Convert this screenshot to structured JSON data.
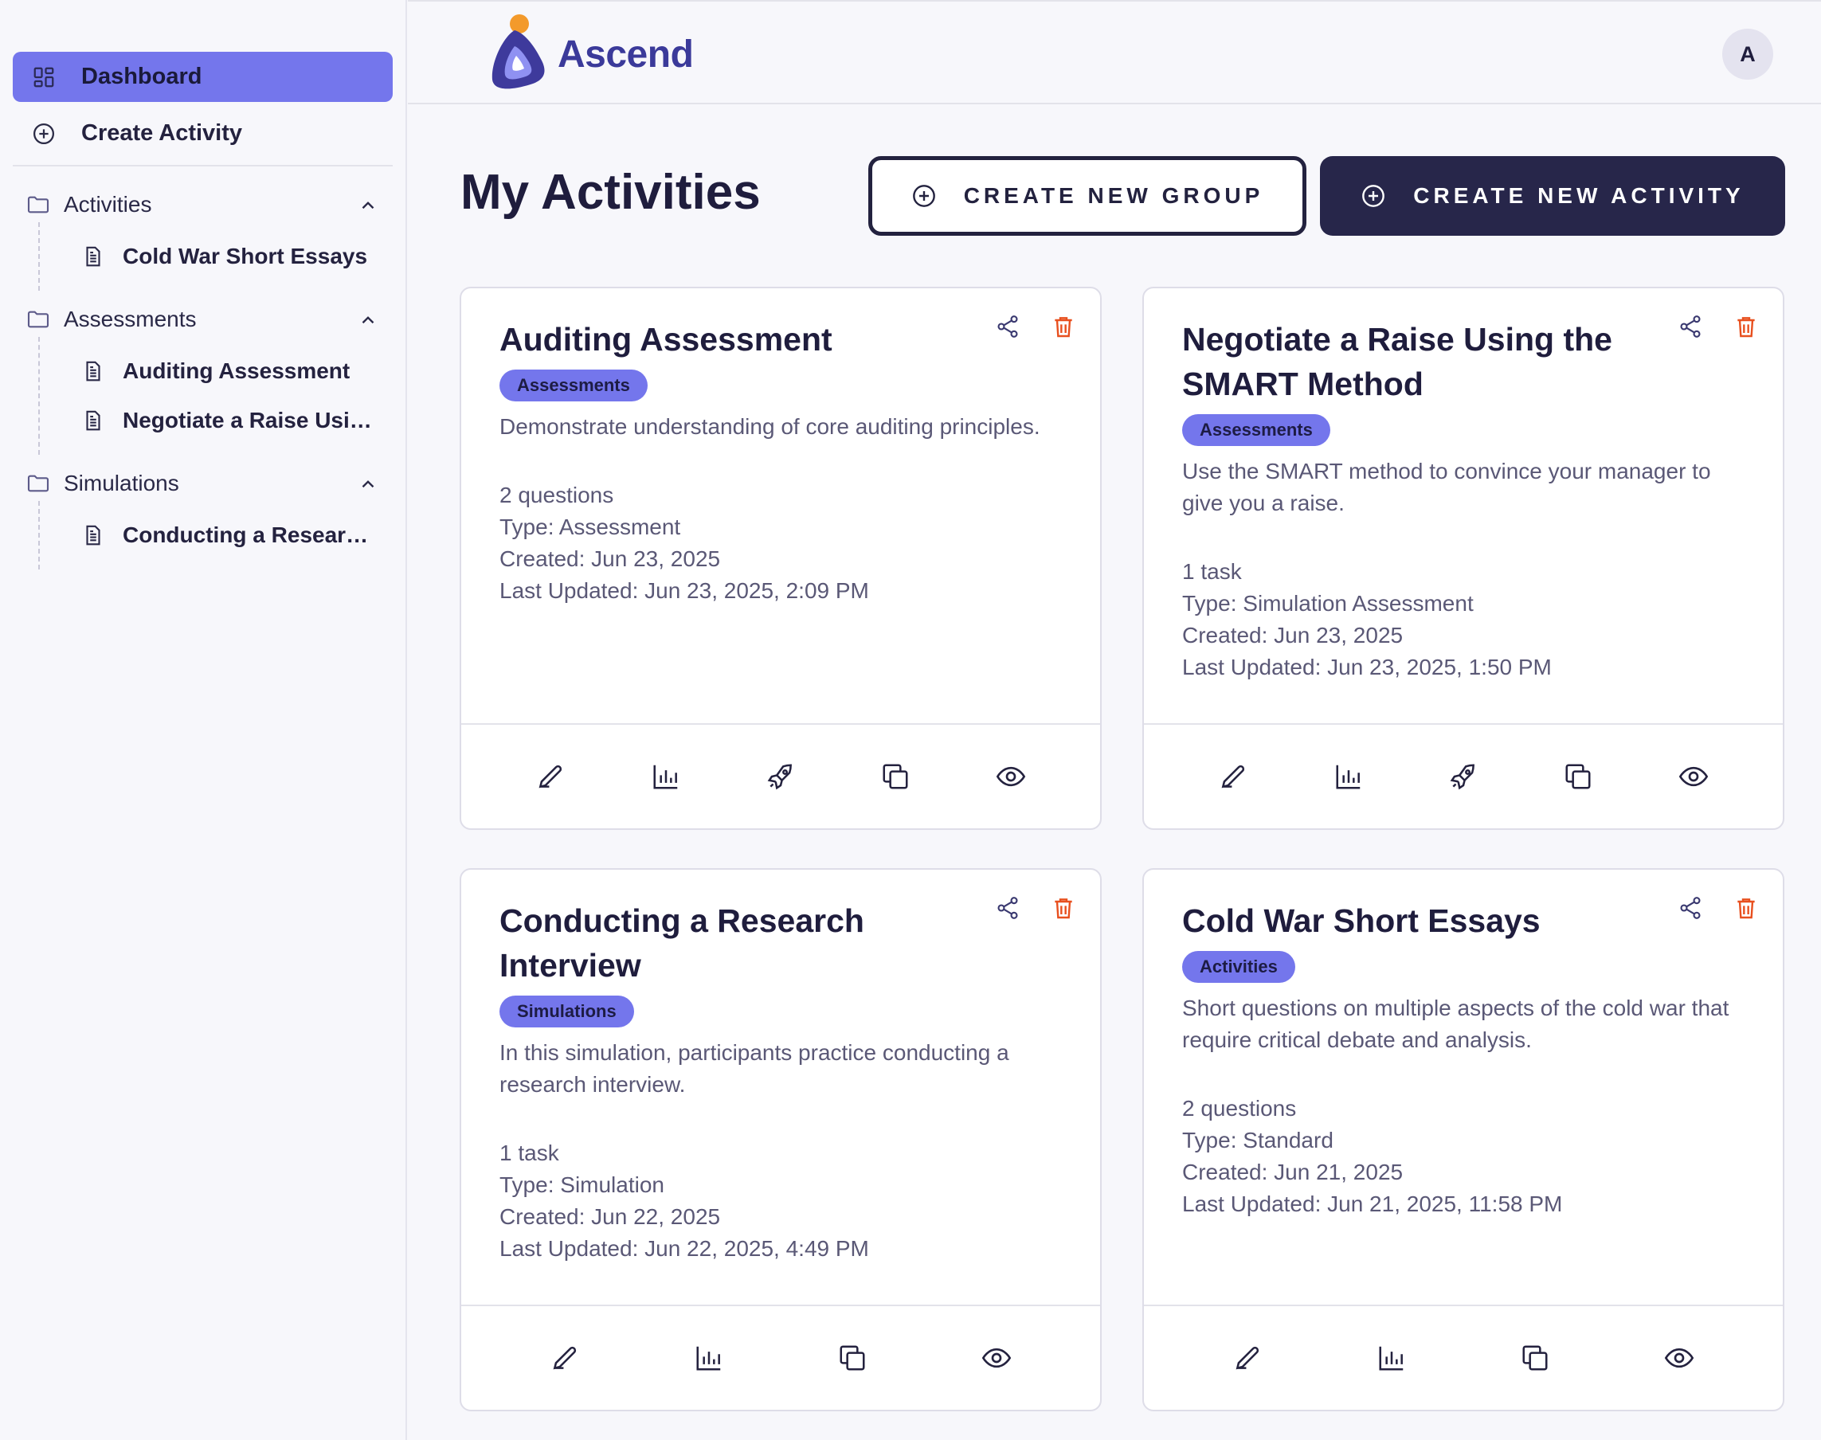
{
  "app": {
    "name": "Ascend",
    "user_initial": "A"
  },
  "sidebar": {
    "nav": [
      {
        "label": "Dashboard",
        "icon": "grid-icon"
      },
      {
        "label": "Create Activity",
        "icon": "plus-circle-icon"
      }
    ],
    "groups": [
      {
        "label": "Activities",
        "items": [
          "Cold War Short Essays"
        ]
      },
      {
        "label": "Assessments",
        "items": [
          "Auditing Assessment",
          "Negotiate a Raise Using the SMART Method"
        ]
      },
      {
        "label": "Simulations",
        "items": [
          "Conducting a Research Interview"
        ]
      }
    ]
  },
  "main": {
    "title": "My Activities",
    "create_group": "CREATE NEW GROUP",
    "create_activity": "CREATE NEW ACTIVITY"
  },
  "cards": [
    {
      "title": "Auditing Assessment",
      "badge": "Assessments",
      "description": "Demonstrate understanding of core auditing principles.",
      "count": "2 questions",
      "type": "Type: Assessment",
      "created": "Created: Jun 23, 2025",
      "updated": "Last Updated: Jun 23, 2025, 2:09 PM"
    },
    {
      "title": "Negotiate a Raise Using the SMART Method",
      "badge": "Assessments",
      "description": "Use the SMART method to convince your manager to give you a raise.",
      "count": "1 task",
      "type": "Type: Simulation Assessment",
      "created": "Created: Jun 23, 2025",
      "updated": "Last Updated: Jun 23, 2025, 1:50 PM"
    },
    {
      "title": "Conducting a Research Interview",
      "badge": "Simulations",
      "description": "In this simulation, participants practice conducting a research interview.",
      "count": "1 task",
      "type": "Type: Simulation",
      "created": "Created: Jun 22, 2025",
      "updated": "Last Updated: Jun 22, 2025, 4:49 PM"
    },
    {
      "title": "Cold War Short Essays",
      "badge": "Activities",
      "description": "Short questions on multiple aspects of the cold war that require critical debate and analysis.",
      "count": "2 questions",
      "type": "Type: Standard",
      "created": "Created: Jun 21, 2025",
      "updated": "Last Updated: Jun 21, 2025, 11:58 PM"
    }
  ],
  "colors": {
    "accent": "#7476ec",
    "dark": "#27264a",
    "danger": "#e8501f",
    "logo_dot": "#f39a2b"
  }
}
